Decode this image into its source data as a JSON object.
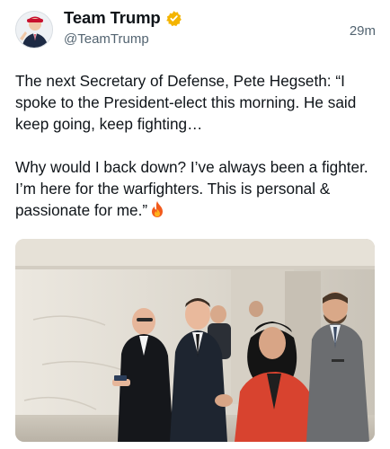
{
  "author": {
    "display_name": "Team Trump",
    "handle": "@TeamTrump",
    "verified": true,
    "verified_color": "#f4c12b"
  },
  "post": {
    "time": "29m",
    "text": "The next Secretary of Defense, Pete Hegseth: “I spoke to the President-elect this morning. He said keep going, keep fighting…\n\nWhy would I back down? I’ve always been a fighter. I’m here for the warfighters. This is personal & passionate for me.”",
    "emoji": "fire-emoji"
  },
  "icons": {
    "avatar": "avatar-photo",
    "verified": "verified-badge-icon",
    "emoji": "fire-icon"
  }
}
